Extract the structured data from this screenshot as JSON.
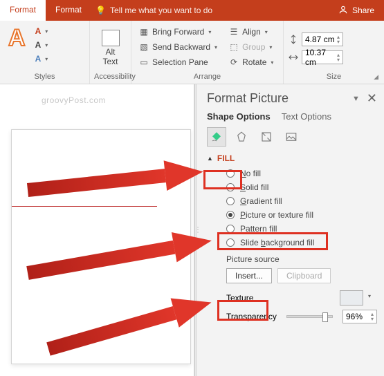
{
  "ribbonTabs": {
    "format1": "Format",
    "format2": "Format",
    "tellMe": "Tell me what you want to do",
    "share": "Share"
  },
  "groups": {
    "styles": "Styles",
    "accessibility": "Accessibility",
    "arrange": "Arrange",
    "size": "Size",
    "altText": "Alt\nText",
    "bringForward": "Bring Forward",
    "sendBackward": "Send Backward",
    "selectionPane": "Selection Pane",
    "align": "Align",
    "group": "Group",
    "rotate": "Rotate"
  },
  "size": {
    "height": "4.87 cm",
    "width": "10.37 cm"
  },
  "watermark": "groovyPost.com",
  "pane": {
    "title": "Format Picture",
    "tabShape": "Shape Options",
    "tabText": "Text Options",
    "sectionFill": "Fill",
    "radios": {
      "noFill": "No fill",
      "solidFill": "Solid fill",
      "gradientFill": "Gradient fill",
      "pictureFill": "Picture or texture fill",
      "patternFill": "Pattern fill",
      "slideBgFill": "Slide background fill"
    },
    "pictureSource": "Picture source",
    "insert": "Insert...",
    "clipboard": "Clipboard",
    "texture": "Texture",
    "transparency": "Transparency",
    "transparencyValue": "96%"
  }
}
